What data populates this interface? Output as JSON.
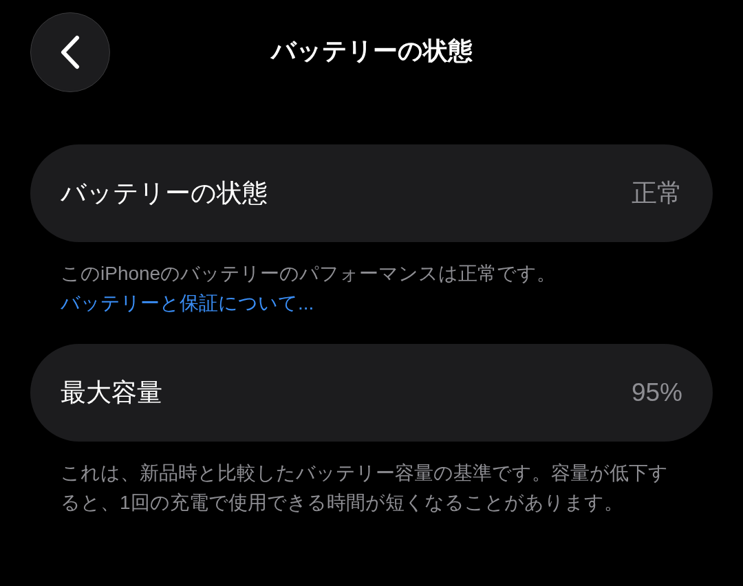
{
  "header": {
    "title": "バッテリーの状態"
  },
  "sections": [
    {
      "label": "バッテリーの状態",
      "value": "正常",
      "footer": {
        "text": "このiPhoneのバッテリーのパフォーマンスは正常です。",
        "link": "バッテリーと保証について..."
      }
    },
    {
      "label": "最大容量",
      "value": "95%",
      "footer": {
        "text": "これは、新品時と比較したバッテリー容量の基準です。容量が低下すると、1回の充電で使用できる時間が短くなることがあります。"
      }
    }
  ]
}
